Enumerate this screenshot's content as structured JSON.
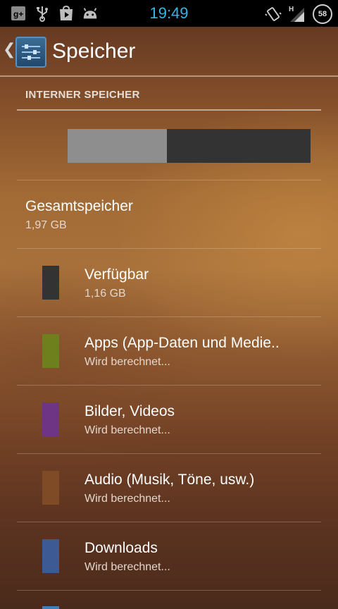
{
  "statusbar": {
    "time": "19:49",
    "battery_level": "58",
    "icons": [
      "google-plus-icon",
      "usb-icon",
      "play-store-icon",
      "android-debug-icon",
      "vibrate-icon",
      "hspa-icon",
      "signal-icon",
      "battery-icon"
    ],
    "time_color": "#33b5e5"
  },
  "actionbar": {
    "title": "Speicher",
    "icon": "storage-settings-icon"
  },
  "storage": {
    "section_header": "INTERNER SPEICHER",
    "used_fraction": 0.41,
    "total_label": "Gesamtspeicher",
    "total_value": "1,97 GB",
    "categories": [
      {
        "label": "Verfügbar",
        "value": "1,16 GB",
        "color": "#333333"
      },
      {
        "label": "Apps (App-Daten und Medie..",
        "value": "Wird berechnet...",
        "color": "#6e7f1e"
      },
      {
        "label": "Bilder, Videos",
        "value": "Wird berechnet...",
        "color": "#6d3584"
      },
      {
        "label": "Audio (Musik, Töne, usw.)",
        "value": "Wird berechnet...",
        "color": "#7f4a26"
      },
      {
        "label": "Downloads",
        "value": "Wird berechnet...",
        "color": "#3d5a94"
      }
    ]
  }
}
